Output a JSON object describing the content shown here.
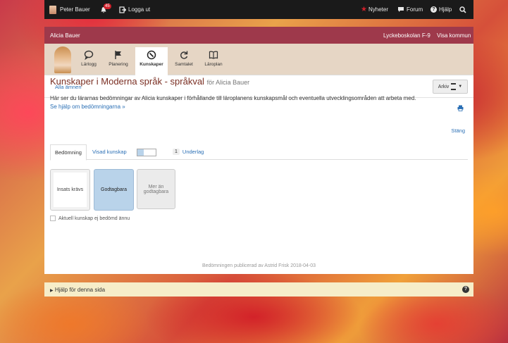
{
  "topbar": {
    "user_name": "Peter Bauer",
    "notification_count": "45",
    "logout_label": "Logga ut",
    "news_label": "Nyheter",
    "forum_label": "Forum",
    "help_label": "Hjälp"
  },
  "userbar": {
    "student_name": "Alicia Bauer",
    "school": "Lyckeboskolan F-9",
    "show_municipality": "Visa kommun"
  },
  "nav_tabs": [
    {
      "label": "Lärlogg",
      "icon": "chat-bubble-icon"
    },
    {
      "label": "Planering",
      "icon": "flag-icon"
    },
    {
      "label": "Kunskaper",
      "icon": "compass-icon",
      "active": true
    },
    {
      "label": "Samtalet",
      "icon": "refresh-icon"
    },
    {
      "label": "Läroplan",
      "icon": "book-icon"
    }
  ],
  "subnav": {
    "all_subjects": "Alla ämnen",
    "archive_label": "Arkiv"
  },
  "main": {
    "title": "Kunskaper i Moderna språk - språkval",
    "title_for": "för Alicia Bauer",
    "description": "Här ser du lärarnas bedömningar av Alicia kunskaper i förhållande till läroplanens kunskapsmål och eventuella utvecklingsområden att arbeta med.",
    "help_link": "Se hjälp om bedömningarna »",
    "close_label": "Stäng"
  },
  "row_tabs": {
    "assessment": "Bedömning",
    "show_knowledge": "Visad kunskap",
    "evidence_count": "1",
    "evidence_label": "Underlag"
  },
  "levels": [
    {
      "label": "Insats krävs",
      "selected": false
    },
    {
      "label": "Godtagbara",
      "selected": true
    },
    {
      "label": "Mer än godtagbara",
      "selected": false
    }
  ],
  "not_assessed_label": "Aktuell kunskap ej bedömd ännu",
  "footer": "Bedömningen publicerad av Astrid Frisk 2018-04-03",
  "help_bar": {
    "label": "Hjälp för denna sida"
  },
  "colors": {
    "accent_link": "#2a6fb5",
    "title_color": "#7a2e22",
    "selected_level": "#b9d3ea",
    "topbar": "#1a1a1a"
  }
}
